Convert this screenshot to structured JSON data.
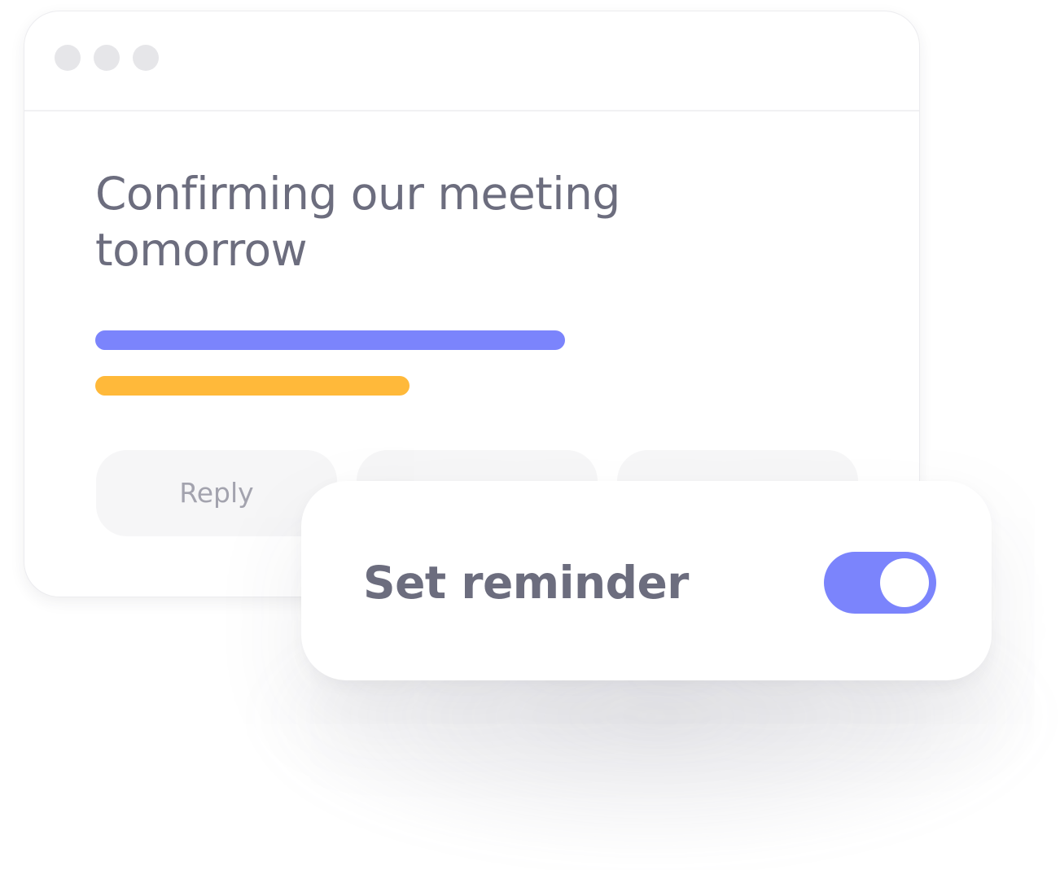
{
  "email": {
    "subject": "Confirming our meeting tomorrow",
    "actions": [
      "Reply",
      "",
      ""
    ]
  },
  "reminder": {
    "label": "Set reminder",
    "enabled": true
  },
  "colors": {
    "accent": "#7b84fc",
    "highlight": "#ffb93a",
    "text": "#6c6d7e",
    "muted_text": "#a3a3ae"
  }
}
